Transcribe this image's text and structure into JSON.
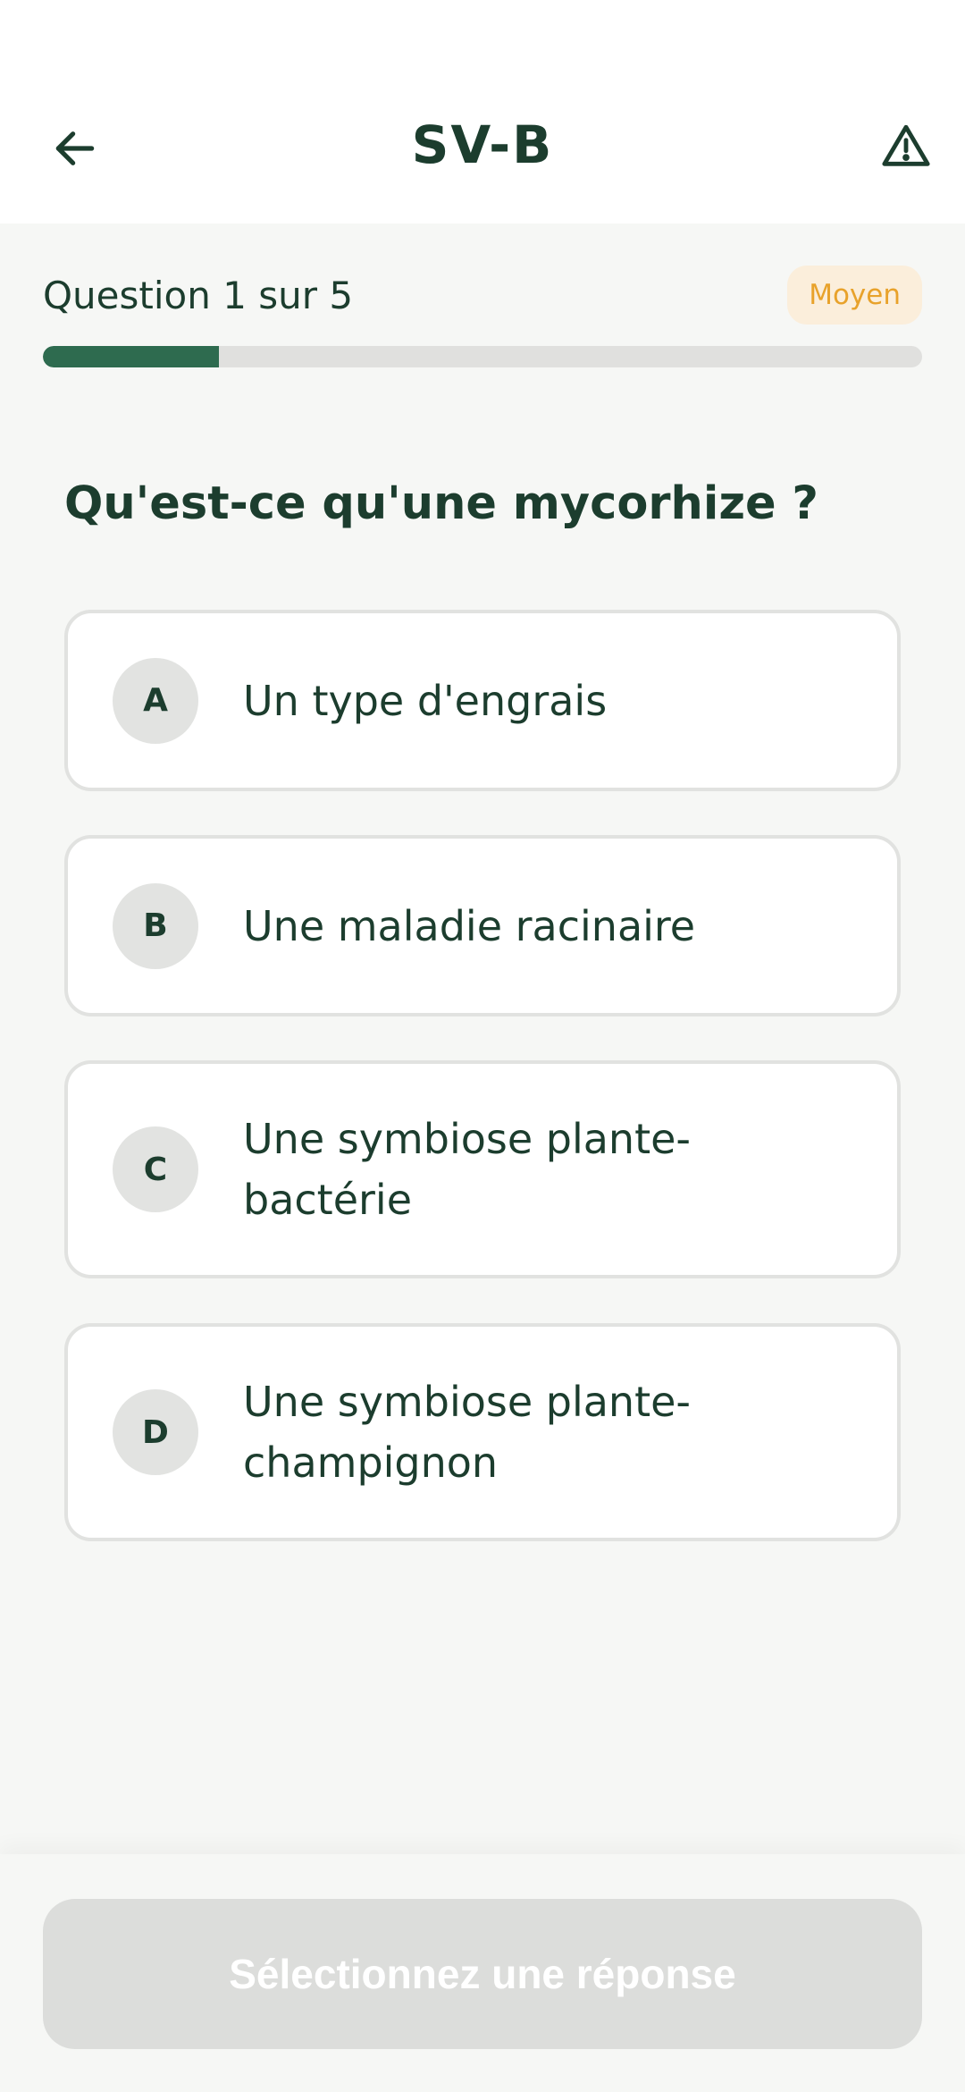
{
  "header": {
    "title": "SV-B",
    "back_icon": "arrow-left-icon",
    "warning_icon": "warning-triangle-icon"
  },
  "progress": {
    "label": "Question 1 sur 5",
    "current": 1,
    "total": 5,
    "fraction": 0.2,
    "difficulty": "Moyen"
  },
  "question": {
    "text": "Qu'est-ce qu'une mycorhize ?"
  },
  "options": [
    {
      "letter": "A",
      "text": "Un type d'engrais"
    },
    {
      "letter": "B",
      "text": "Une maladie racinaire"
    },
    {
      "letter": "C",
      "text": "Une symbiose plante-bactérie"
    },
    {
      "letter": "D",
      "text": "Une symbiose plante-champignon"
    }
  ],
  "footer": {
    "submit_label": "Sélectionnez une réponse"
  },
  "colors": {
    "primary": "#1c3d2e",
    "progress_fill": "#2e6b4f",
    "badge_bg": "#fbeedb",
    "badge_text": "#e8a22b",
    "disabled_button": "#dcdddb"
  }
}
